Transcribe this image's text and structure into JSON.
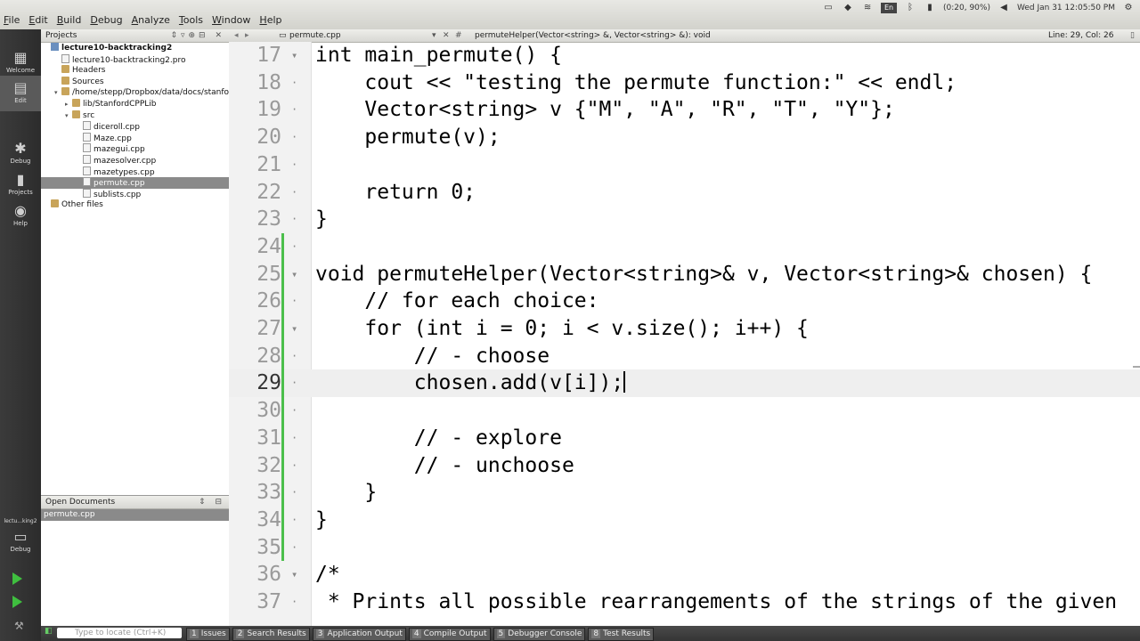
{
  "menu": [
    "File",
    "Edit",
    "Build",
    "Debug",
    "Analyze",
    "Tools",
    "Window",
    "Help"
  ],
  "tray": {
    "lang": "En",
    "battery": "(0:20, 90%)",
    "datetime": "Wed Jan 31  12:05:50 PM"
  },
  "modes": [
    "Welcome",
    "Edit",
    "Debug",
    "Projects",
    "Help"
  ],
  "kit": {
    "project": "lectu...king2",
    "label": "Debug"
  },
  "projects": {
    "header": "Projects",
    "items": [
      {
        "label": "lecture10-backtracking2",
        "depth": 0,
        "icon": "proj",
        "bold": true
      },
      {
        "label": "lecture10-backtracking2.pro",
        "depth": 1,
        "icon": "file"
      },
      {
        "label": "Headers",
        "depth": 1,
        "icon": "folder"
      },
      {
        "label": "Sources",
        "depth": 1,
        "icon": "folder"
      },
      {
        "label": "/home/stepp/Dropbox/data/docs/stanford",
        "depth": 1,
        "icon": "folder",
        "tri": "▾"
      },
      {
        "label": "lib/StanfordCPPLib",
        "depth": 2,
        "icon": "folder",
        "tri": "▸"
      },
      {
        "label": "src",
        "depth": 2,
        "icon": "folder",
        "tri": "▾"
      },
      {
        "label": "diceroll.cpp",
        "depth": 3,
        "icon": "file"
      },
      {
        "label": "Maze.cpp",
        "depth": 3,
        "icon": "file"
      },
      {
        "label": "mazegui.cpp",
        "depth": 3,
        "icon": "file"
      },
      {
        "label": "mazesolver.cpp",
        "depth": 3,
        "icon": "file"
      },
      {
        "label": "mazetypes.cpp",
        "depth": 3,
        "icon": "file"
      },
      {
        "label": "permute.cpp",
        "depth": 3,
        "icon": "file",
        "selected": true
      },
      {
        "label": "sublists.cpp",
        "depth": 3,
        "icon": "file"
      },
      {
        "label": "Other files",
        "depth": 0,
        "icon": "folder"
      }
    ]
  },
  "open_documents": {
    "header": "Open Documents",
    "items": [
      "permute.cpp"
    ]
  },
  "editor": {
    "file": "permute.cpp",
    "symbol": "permuteHelper(Vector<string> &, Vector<string> &): void",
    "position": "Line: 29, Col: 26",
    "lines": [
      {
        "n": "17",
        "text": "int main_permute() {",
        "fold": "▾"
      },
      {
        "n": "18",
        "text": "    cout << \"testing the permute function:\" << endl;"
      },
      {
        "n": "19",
        "text": "    Vector<string> v {\"M\", \"A\", \"R\", \"T\", \"Y\"};"
      },
      {
        "n": "20",
        "text": "    permute(v);"
      },
      {
        "n": "21",
        "text": ""
      },
      {
        "n": "22",
        "text": "    return 0;"
      },
      {
        "n": "23",
        "text": "}"
      },
      {
        "n": "24",
        "text": ""
      },
      {
        "n": "25",
        "text": "void permuteHelper(Vector<string>& v, Vector<string>& chosen) {",
        "fold": "▾"
      },
      {
        "n": "26",
        "text": "    // for each choice:"
      },
      {
        "n": "27",
        "text": "    for (int i = 0; i < v.size(); i++) {",
        "fold": "▾"
      },
      {
        "n": "28",
        "text": "        // - choose"
      },
      {
        "n": "29",
        "text": "        chosen.add(v[i]);",
        "current": true
      },
      {
        "n": "30",
        "text": ""
      },
      {
        "n": "31",
        "text": "        // - explore"
      },
      {
        "n": "32",
        "text": "        // - unchoose"
      },
      {
        "n": "33",
        "text": "    }"
      },
      {
        "n": "34",
        "text": "}"
      },
      {
        "n": "35",
        "text": ""
      },
      {
        "n": "36",
        "text": "/*",
        "fold": "▾"
      },
      {
        "n": "37",
        "text": " * Prints all possible rearrangements of the strings of the given"
      }
    ]
  },
  "status": {
    "locate_placeholder": "Type to locate (Ctrl+K)",
    "tabs": [
      {
        "num": "1",
        "label": "Issues"
      },
      {
        "num": "2",
        "label": "Search Results"
      },
      {
        "num": "3",
        "label": "Application Output"
      },
      {
        "num": "4",
        "label": "Compile Output"
      },
      {
        "num": "5",
        "label": "Debugger Console"
      },
      {
        "num": "8",
        "label": "Test Results"
      }
    ]
  }
}
